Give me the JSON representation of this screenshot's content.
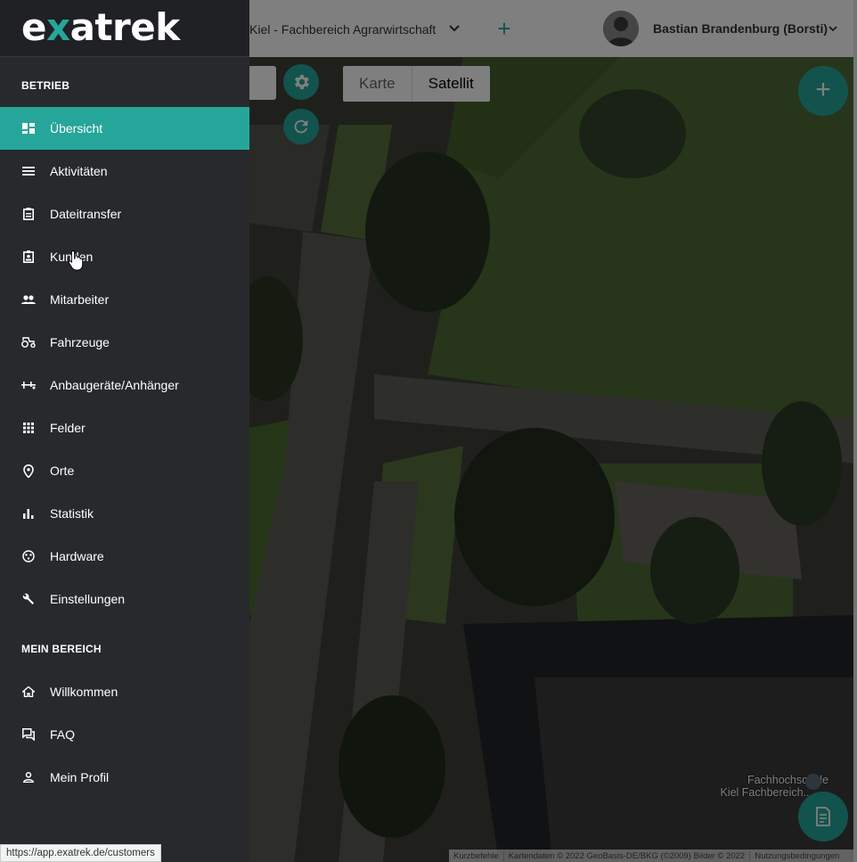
{
  "topbar": {
    "farm_name": "Kiel - Fachbereich Agrarwirtschaft",
    "add_symbol": "+",
    "user_name": "Bastian Brandenburg (Borsti)"
  },
  "map": {
    "tabs": [
      "Karte",
      "Satellit"
    ],
    "active_tab": "Satellit",
    "fab_add_symbol": "+",
    "poi_label_line1": "Fachhochschule",
    "poi_label_line2": "Kiel Fachbereich...",
    "attribution": {
      "shortcuts": "Kurzbefehle",
      "data": "Kartendaten © 2022 GeoBasis-DE/BKG (©2009) Bilder © 2022",
      "terms": "Nutzungsbedingungen"
    }
  },
  "sidebar": {
    "logo_prefix": "e",
    "logo_x": "x",
    "logo_suffix": "atrek",
    "section_business": "BETRIEB",
    "section_mine": "MEIN BEREICH",
    "business_items": [
      {
        "label": "Übersicht",
        "icon": "dashboard-icon",
        "active": true
      },
      {
        "label": "Aktivitäten",
        "icon": "list-icon",
        "active": false
      },
      {
        "label": "Dateitransfer",
        "icon": "clipboard-icon",
        "active": false
      },
      {
        "label": "Kunden",
        "icon": "contact-card-icon",
        "active": false
      },
      {
        "label": "Mitarbeiter",
        "icon": "people-icon",
        "active": false
      },
      {
        "label": "Fahrzeuge",
        "icon": "tractor-icon",
        "active": false
      },
      {
        "label": "Anbaugeräte/Anhänger",
        "icon": "implement-icon",
        "active": false
      },
      {
        "label": "Felder",
        "icon": "grid-icon",
        "active": false
      },
      {
        "label": "Orte",
        "icon": "location-pin-icon",
        "active": false
      },
      {
        "label": "Statistik",
        "icon": "bar-chart-icon",
        "active": false
      },
      {
        "label": "Hardware",
        "icon": "hardware-icon",
        "active": false
      },
      {
        "label": "Einstellungen",
        "icon": "wrench-icon",
        "active": false
      }
    ],
    "mine_items": [
      {
        "label": "Willkommen",
        "icon": "home-icon"
      },
      {
        "label": "FAQ",
        "icon": "forum-icon"
      },
      {
        "label": "Mein Profil",
        "icon": "person-icon"
      }
    ]
  },
  "status_bar_url": "https://app.exatrek.de/customers",
  "colors": {
    "accent": "#26a69a",
    "sidebar_bg": "#27292d"
  }
}
